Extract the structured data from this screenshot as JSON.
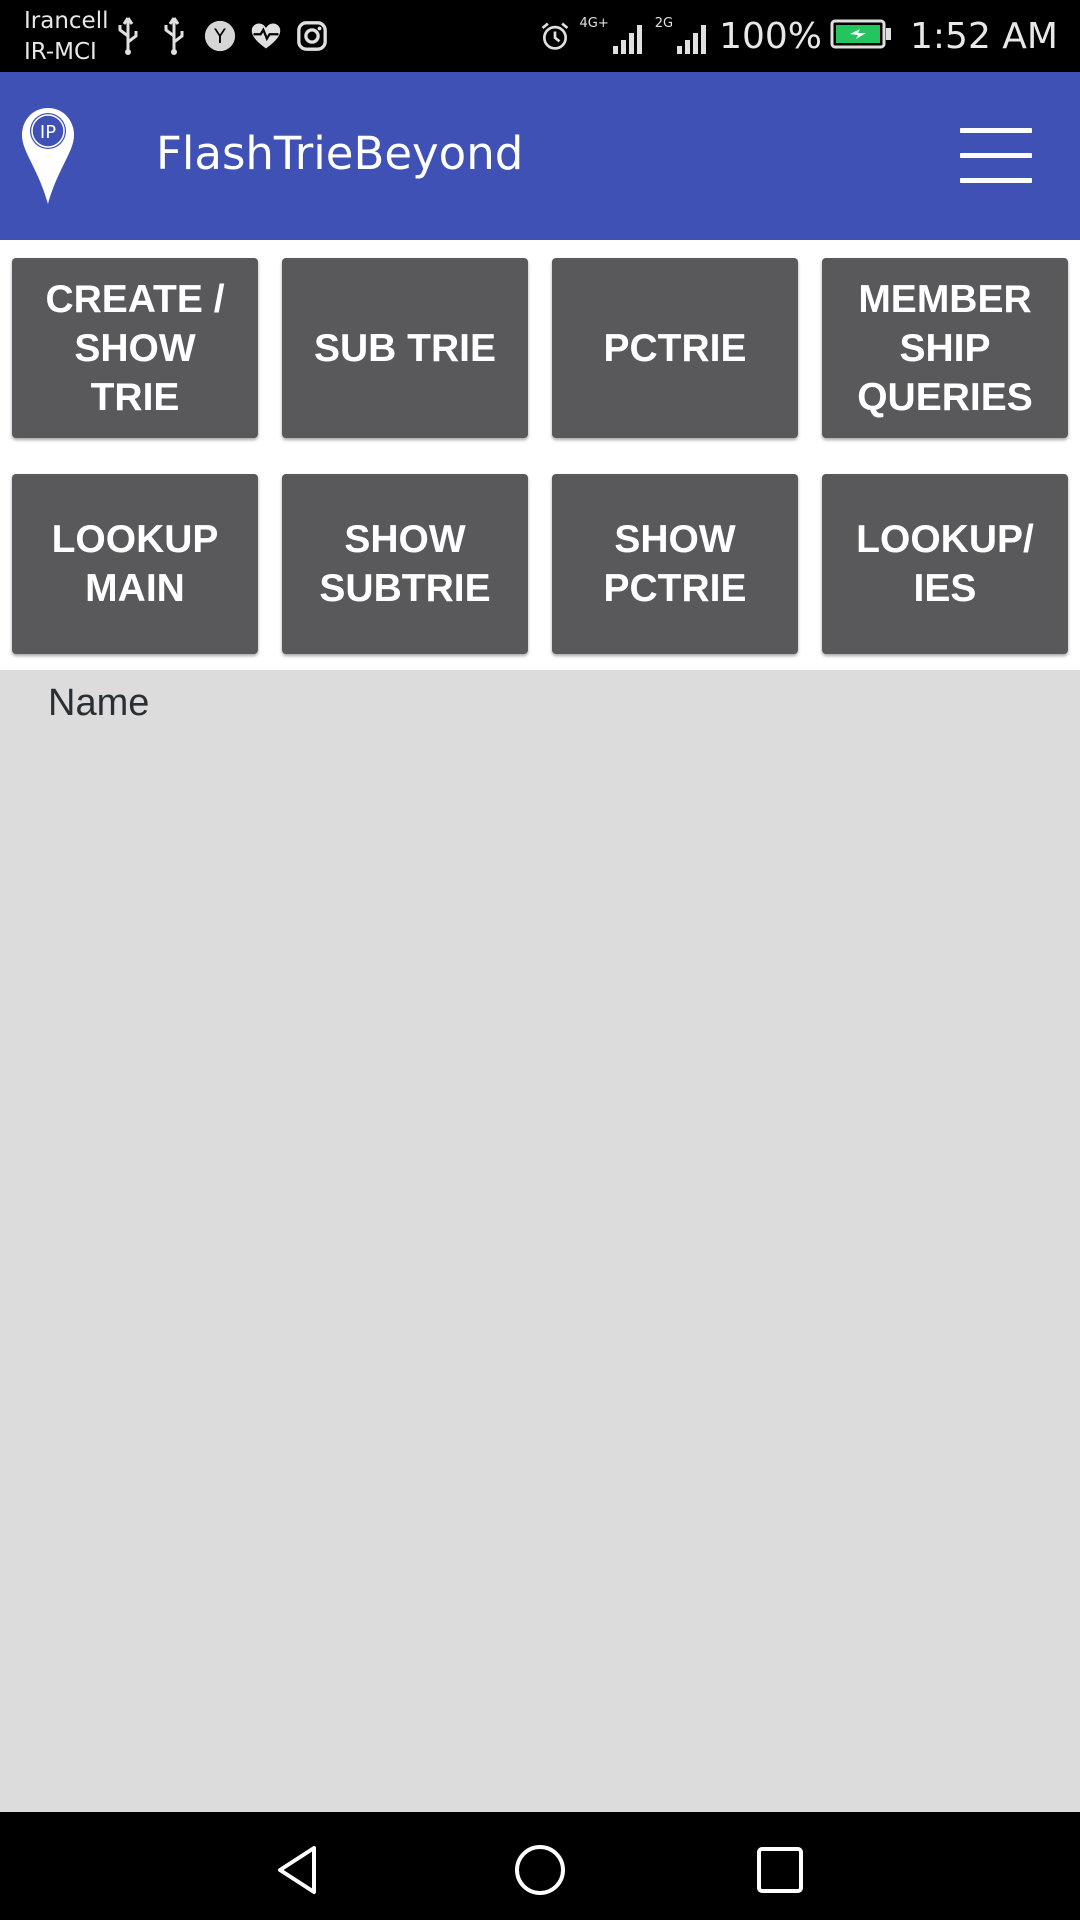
{
  "status_bar": {
    "carrier_line1": "Irancell",
    "carrier_line2": "IR-MCI",
    "left_icons": [
      "usb-icon",
      "usb-icon",
      "y-app-icon",
      "heart-pulse-icon",
      "instagram-icon"
    ],
    "network_primary": "4G+",
    "network_secondary": "2G",
    "battery_percent": "100%",
    "battery_charging": true,
    "time": "1:52 AM"
  },
  "app_bar": {
    "logo_text": "IP",
    "title": "FlashTrieBeyond",
    "background_color": "#3f51b5"
  },
  "buttons": {
    "create_show_trie": "CREATE /\nSHOW\nTRIE",
    "sub_trie": "SUB TRIE",
    "pctrie": "PCTRIE",
    "membership_queries": "MEMBER\nSHIP\nQUERIES",
    "lookup_main": "LOOKUP\nMAIN",
    "show_subtrie": "SHOW\nSUBTRIE",
    "show_pctrie": "SHOW\nPCTRIE",
    "lookup_ies": "LOOKUP/\nIES",
    "color": "#59595b"
  },
  "content": {
    "name_label": "Name"
  },
  "nav_bar": {
    "icons": [
      "back-icon",
      "home-icon",
      "recents-icon"
    ]
  }
}
